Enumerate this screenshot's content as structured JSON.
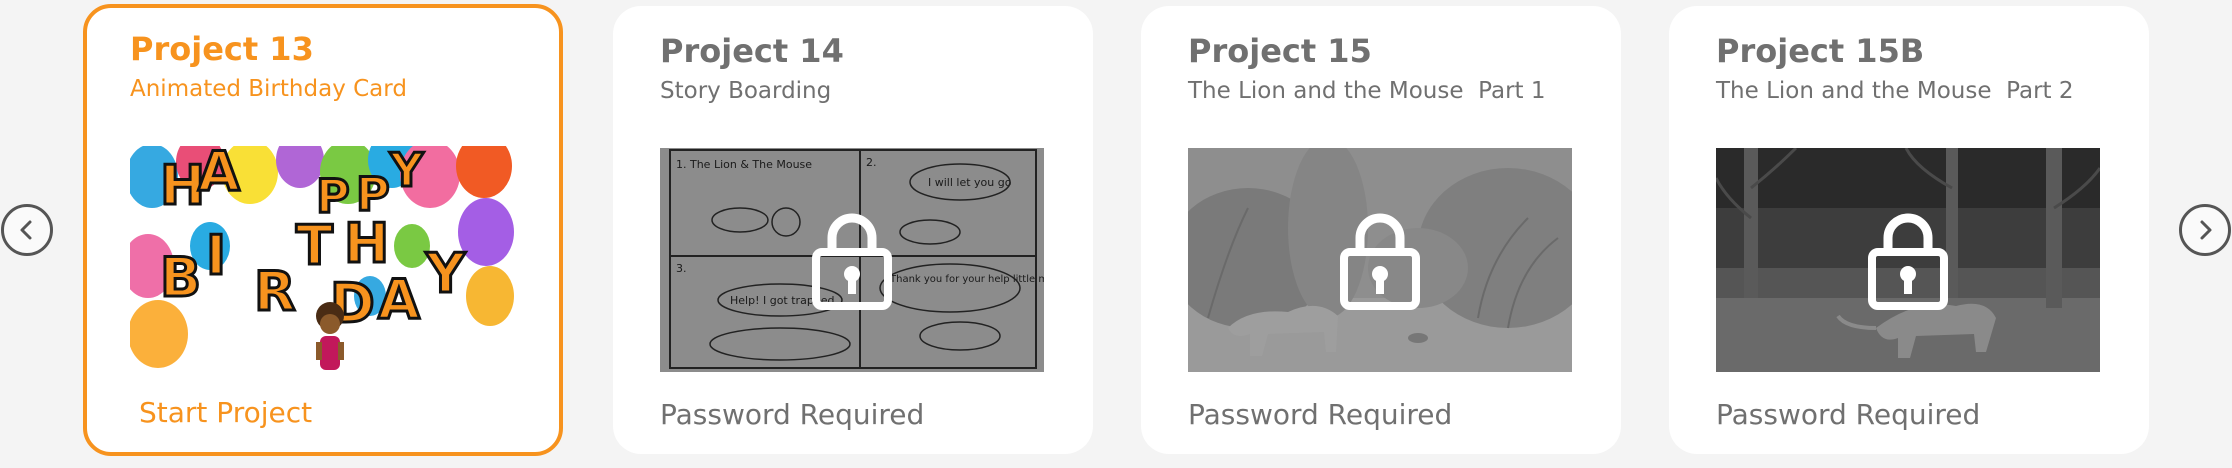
{
  "carousel": {
    "prev_icon": "chevron-left-icon",
    "next_icon": "chevron-right-icon",
    "accent_color": "#f7931e",
    "muted_color": "#707070",
    "cards": [
      {
        "title": "Project 13",
        "subtitle": "Animated Birthday Card",
        "footer": "Start Project",
        "locked": false,
        "thumbnail_letters": [
          "H",
          "A",
          "P",
          "P",
          "Y",
          "B",
          "I",
          "R",
          "T",
          "H",
          "D",
          "A",
          "Y"
        ]
      },
      {
        "title": "Project 14",
        "subtitle": "Story Boarding",
        "footer": "Password Required",
        "locked": true,
        "thumbnail_texts": [
          "1. The Lion & The Mouse",
          "2.",
          "I will let you go",
          "3.",
          "Help! I got trapped",
          "Thank you for your help little mouse"
        ]
      },
      {
        "title": "Project 15",
        "subtitle": "The Lion and the Mouse  Part 1",
        "footer": "Password Required",
        "locked": true
      },
      {
        "title": "Project 15B",
        "subtitle": "The Lion and the Mouse  Part 2",
        "footer": "Password Required",
        "locked": true
      }
    ]
  }
}
